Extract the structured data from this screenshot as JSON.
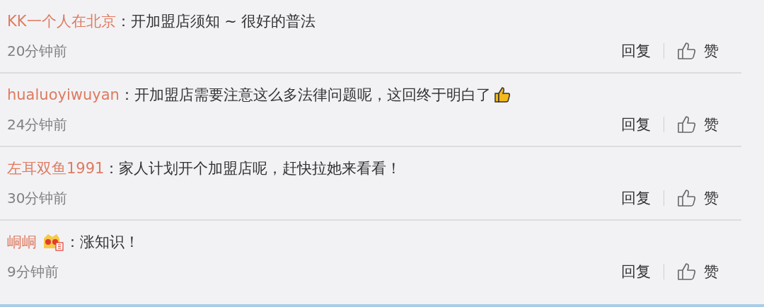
{
  "comments": [
    {
      "user": "KK一个人在北京",
      "badge": false,
      "text": "：开加盟店须知 ~ 很好的普法",
      "thumb_emoji": false,
      "time": "20分钟前",
      "reply": "回复",
      "like": "赞"
    },
    {
      "user": "hualuoyiwuyan",
      "badge": false,
      "text": "：开加盟店需要注意这么多法律问题呢，这回终于明白了",
      "thumb_emoji": true,
      "time": "24分钟前",
      "reply": "回复",
      "like": "赞"
    },
    {
      "user": "左耳双鱼1991",
      "badge": false,
      "text": "：家人计划开个加盟店呢，赶快拉她来看看！",
      "thumb_emoji": false,
      "time": "30分钟前",
      "reply": "回复",
      "like": "赞"
    },
    {
      "user": "峒峒",
      "badge": true,
      "text": "：涨知识！",
      "thumb_emoji": false,
      "time": "9分钟前",
      "reply": "回复",
      "like": "赞"
    }
  ]
}
